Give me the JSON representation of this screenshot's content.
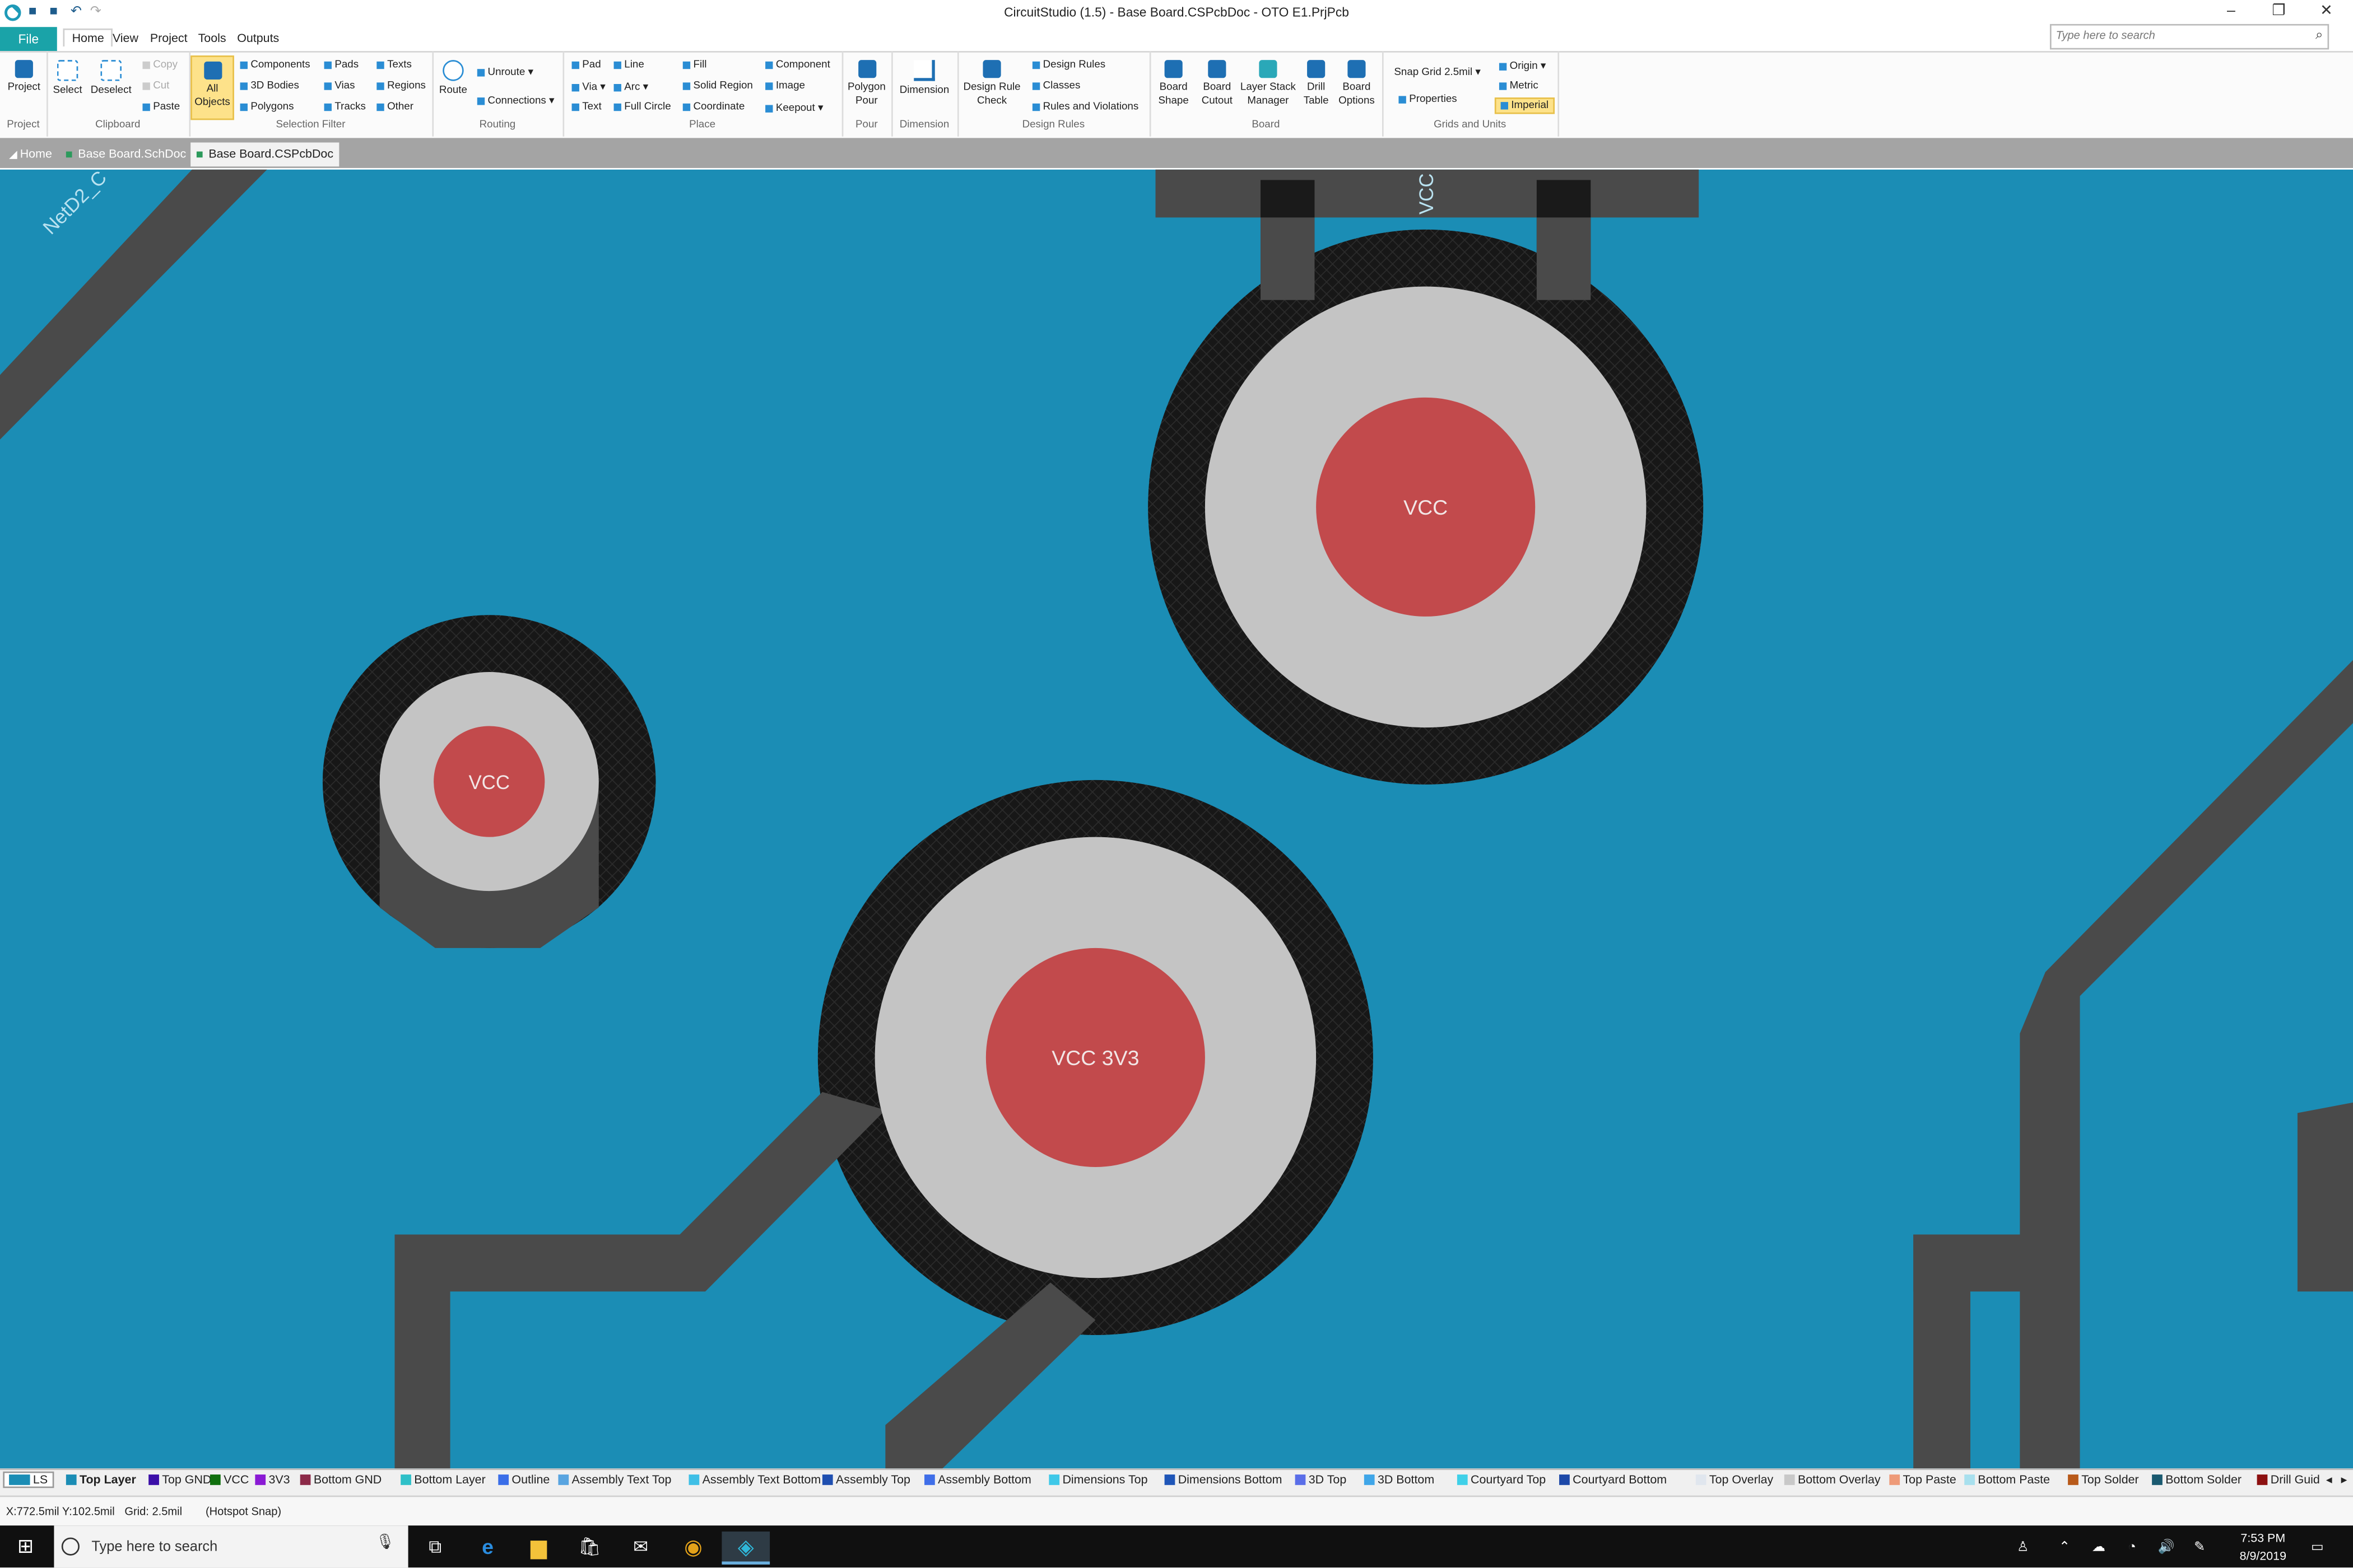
{
  "window": {
    "title": "CircuitStudio (1.5) - Base Board.CSPcbDoc - OTO E1.PrjPcb",
    "controls": [
      "–",
      "❐",
      "✕"
    ]
  },
  "menu": {
    "file": "File",
    "items": [
      "Home",
      "View",
      "Project",
      "Tools",
      "Outputs"
    ],
    "active": "Home",
    "search_placeholder": "Type here to search"
  },
  "ribbon": {
    "project": {
      "label": "Project",
      "btn": "Project"
    },
    "clipboard": {
      "label": "Clipboard",
      "select": "Select",
      "deselect": "Deselect",
      "copy": "Copy",
      "cut": "Cut",
      "paste": "Paste"
    },
    "selection_filter": {
      "label": "Selection Filter",
      "all_objects_1": "All",
      "all_objects_2": "Objects",
      "components": "Components",
      "bodies": "3D Bodies",
      "polygons": "Polygons",
      "pads": "Pads",
      "vias": "Vias",
      "tracks": "Tracks",
      "texts": "Texts",
      "regions": "Regions",
      "other": "Other"
    },
    "routing": {
      "label": "Routing",
      "route": "Route",
      "unroute": "Unroute",
      "connections": "Connections"
    },
    "place": {
      "label": "Place",
      "pad": "Pad",
      "via": "Via",
      "text": "Text",
      "line": "Line",
      "arc": "Arc",
      "full_circle": "Full Circle",
      "fill": "Fill",
      "solid_region": "Solid Region",
      "coordinate": "Coordinate",
      "component": "Component",
      "image": "Image",
      "keepout": "Keepout"
    },
    "pour": {
      "label": "Pour",
      "btn1": "Polygon",
      "btn2": "Pour"
    },
    "dimension": {
      "label": "Dimension",
      "btn": "Dimension"
    },
    "design_rules": {
      "label": "Design Rules",
      "drc1": "Design Rule",
      "drc2": "Check",
      "rules": "Design Rules",
      "classes": "Classes",
      "violations": "Rules and Violations"
    },
    "board": {
      "label": "Board",
      "shape1": "Board",
      "shape2": "Shape",
      "cutout1": "Board",
      "cutout2": "Cutout",
      "stack1": "Layer Stack",
      "stack2": "Manager",
      "drill1": "Drill",
      "drill2": "Table",
      "opts1": "Board",
      "opts2": "Options"
    },
    "grids": {
      "label": "Grids and Units",
      "snap_label": "Snap Grid",
      "snap_value": "2.5mil",
      "properties": "Properties",
      "origin": "Origin",
      "metric": "Metric",
      "imperial": "Imperial"
    }
  },
  "doc_tabs": [
    "Home",
    "Base Board.SchDoc",
    "Base Board.CSPcbDoc"
  ],
  "active_doc": "Base Board.CSPcbDoc",
  "pcb": {
    "net_label_top_left": "NetD2_C",
    "net_label_top": "VCC",
    "pad_small": "VCC",
    "pad_top_right": "VCC",
    "pad_bottom": "VCC 3V3",
    "colors": {
      "background": "#1b8db5",
      "track": "#4a4a4a",
      "clearance": "#1a1a1a",
      "pad_ring": "#c4c4c4",
      "drill": "#c24a4c"
    }
  },
  "layers": {
    "ls": "LS",
    "items": [
      {
        "name": "Top Layer",
        "color": "#1b8db5"
      },
      {
        "name": "Top GND",
        "color": "#3b0fa8"
      },
      {
        "name": "VCC",
        "color": "#10700e"
      },
      {
        "name": "3V3",
        "color": "#8a1ad4"
      },
      {
        "name": "Bottom GND",
        "color": "#8c2a48"
      },
      {
        "name": "Bottom Layer",
        "color": "#2ec0c8"
      },
      {
        "name": "Outline",
        "color": "#3a6ee8"
      },
      {
        "name": "Assembly Text Top",
        "color": "#58a4e0"
      },
      {
        "name": "Assembly Text Bottom",
        "color": "#3fbfe6"
      },
      {
        "name": "Assembly Top",
        "color": "#1f4fb0"
      },
      {
        "name": "Assembly Bottom",
        "color": "#3f6ee8"
      },
      {
        "name": "Dimensions Top",
        "color": "#3fc8e8"
      },
      {
        "name": "Dimensions Bottom",
        "color": "#1f56b8"
      },
      {
        "name": "3D Top",
        "color": "#5a6ee8"
      },
      {
        "name": "3D Bottom",
        "color": "#3fa6e8"
      },
      {
        "name": "Courtyard Top",
        "color": "#3fd0e8"
      },
      {
        "name": "Courtyard Bottom",
        "color": "#1c48a8"
      },
      {
        "name": "Top Overlay",
        "color": "#e0e6ee"
      },
      {
        "name": "Bottom Overlay",
        "color": "#c8c8c8"
      },
      {
        "name": "Top Paste",
        "color": "#ee9a78"
      },
      {
        "name": "Bottom Paste",
        "color": "#a8e0ee"
      },
      {
        "name": "Top Solder",
        "color": "#b85a1a"
      },
      {
        "name": "Bottom Solder",
        "color": "#1a5a70"
      },
      {
        "name": "Drill Guid",
        "color": "#8c1010"
      }
    ]
  },
  "status": {
    "coords": "X:772.5mil Y:102.5mil",
    "grid": "Grid: 2.5mil",
    "snap": "(Hotspot Snap)"
  },
  "taskbar": {
    "search_placeholder": "Type here to search",
    "time": "7:53 PM",
    "date": "8/9/2019"
  }
}
